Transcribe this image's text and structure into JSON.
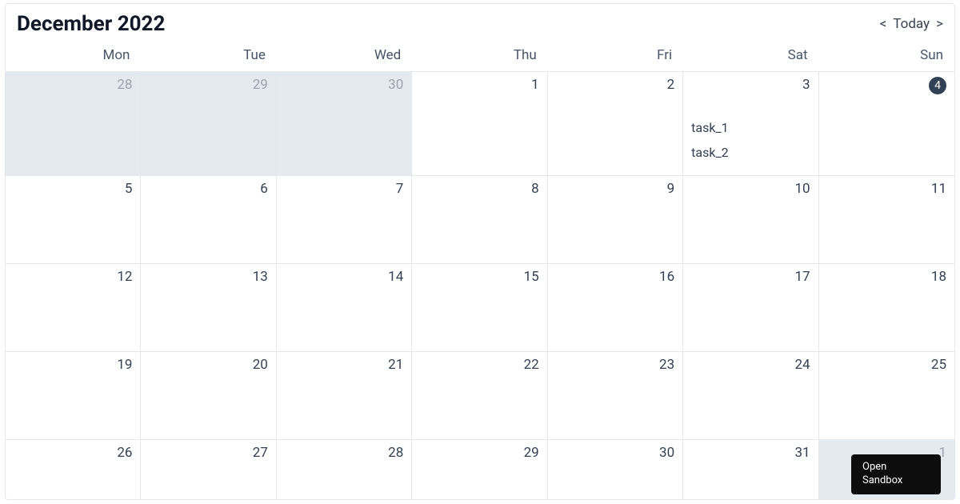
{
  "header": {
    "title": "December 2022",
    "prev": "<",
    "today": "Today",
    "next": ">"
  },
  "daysOfWeek": [
    "Mon",
    "Tue",
    "Wed",
    "Thu",
    "Fri",
    "Sat",
    "Sun"
  ],
  "weeks": [
    {
      "heightClass": "h-tall",
      "days": [
        {
          "num": 28,
          "otherMonth": true,
          "isToday": false,
          "events": []
        },
        {
          "num": 29,
          "otherMonth": true,
          "isToday": false,
          "events": []
        },
        {
          "num": 30,
          "otherMonth": true,
          "isToday": false,
          "events": []
        },
        {
          "num": 1,
          "otherMonth": false,
          "isToday": false,
          "events": []
        },
        {
          "num": 2,
          "otherMonth": false,
          "isToday": false,
          "events": []
        },
        {
          "num": 3,
          "otherMonth": false,
          "isToday": false,
          "events": [
            "task_1",
            "task_2"
          ]
        },
        {
          "num": 4,
          "otherMonth": false,
          "isToday": true,
          "events": []
        }
      ]
    },
    {
      "heightClass": "h-med",
      "days": [
        {
          "num": 5,
          "otherMonth": false,
          "isToday": false,
          "events": []
        },
        {
          "num": 6,
          "otherMonth": false,
          "isToday": false,
          "events": []
        },
        {
          "num": 7,
          "otherMonth": false,
          "isToday": false,
          "events": []
        },
        {
          "num": 8,
          "otherMonth": false,
          "isToday": false,
          "events": []
        },
        {
          "num": 9,
          "otherMonth": false,
          "isToday": false,
          "events": []
        },
        {
          "num": 10,
          "otherMonth": false,
          "isToday": false,
          "events": []
        },
        {
          "num": 11,
          "otherMonth": false,
          "isToday": false,
          "events": []
        }
      ]
    },
    {
      "heightClass": "h-med",
      "days": [
        {
          "num": 12,
          "otherMonth": false,
          "isToday": false,
          "events": []
        },
        {
          "num": 13,
          "otherMonth": false,
          "isToday": false,
          "events": []
        },
        {
          "num": 14,
          "otherMonth": false,
          "isToday": false,
          "events": []
        },
        {
          "num": 15,
          "otherMonth": false,
          "isToday": false,
          "events": []
        },
        {
          "num": 16,
          "otherMonth": false,
          "isToday": false,
          "events": []
        },
        {
          "num": 17,
          "otherMonth": false,
          "isToday": false,
          "events": []
        },
        {
          "num": 18,
          "otherMonth": false,
          "isToday": false,
          "events": []
        }
      ]
    },
    {
      "heightClass": "h-med",
      "days": [
        {
          "num": 19,
          "otherMonth": false,
          "isToday": false,
          "events": []
        },
        {
          "num": 20,
          "otherMonth": false,
          "isToday": false,
          "events": []
        },
        {
          "num": 21,
          "otherMonth": false,
          "isToday": false,
          "events": []
        },
        {
          "num": 22,
          "otherMonth": false,
          "isToday": false,
          "events": []
        },
        {
          "num": 23,
          "otherMonth": false,
          "isToday": false,
          "events": []
        },
        {
          "num": 24,
          "otherMonth": false,
          "isToday": false,
          "events": []
        },
        {
          "num": 25,
          "otherMonth": false,
          "isToday": false,
          "events": []
        }
      ]
    },
    {
      "heightClass": "h-short",
      "days": [
        {
          "num": 26,
          "otherMonth": false,
          "isToday": false,
          "events": []
        },
        {
          "num": 27,
          "otherMonth": false,
          "isToday": false,
          "events": []
        },
        {
          "num": 28,
          "otherMonth": false,
          "isToday": false,
          "events": []
        },
        {
          "num": 29,
          "otherMonth": false,
          "isToday": false,
          "events": []
        },
        {
          "num": 30,
          "otherMonth": false,
          "isToday": false,
          "events": []
        },
        {
          "num": 31,
          "otherMonth": false,
          "isToday": false,
          "events": []
        },
        {
          "num": 1,
          "otherMonth": true,
          "isToday": false,
          "events": []
        }
      ]
    }
  ],
  "sandbox": {
    "line1": "Open",
    "line2": "Sandbox"
  }
}
